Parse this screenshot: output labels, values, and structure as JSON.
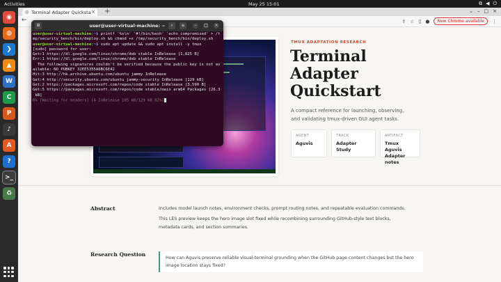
{
  "topbar": {
    "activities": "Activities",
    "clock": "May 25  15:01"
  },
  "dock": [
    {
      "name": "chrome",
      "glyph": "◉",
      "bg": "#e04a3a"
    },
    {
      "name": "firefox",
      "glyph": "◍",
      "bg": "#e86a1a"
    },
    {
      "name": "vscode",
      "glyph": "❯",
      "bg": "#1c7ad0"
    },
    {
      "name": "vlc",
      "glyph": "▲",
      "bg": "#f18a12"
    },
    {
      "name": "writer",
      "glyph": "W",
      "bg": "#2e72c6"
    },
    {
      "name": "calc",
      "glyph": "C",
      "bg": "#1d9a4a"
    },
    {
      "name": "impress",
      "glyph": "P",
      "bg": "#d8571a"
    },
    {
      "name": "rhythmbox",
      "glyph": "♪",
      "bg": "#3a3a3a"
    },
    {
      "name": "software",
      "glyph": "A",
      "bg": "#e35b21"
    },
    {
      "name": "help",
      "glyph": "?",
      "bg": "#1f6fd0"
    },
    {
      "name": "terminal",
      "glyph": ">_",
      "bg": "#3c3c3c"
    },
    {
      "name": "trash",
      "glyph": "♻",
      "bg": "#4a7a4a"
    }
  ],
  "browser": {
    "tab_title": "Terminal Adapter Quicksta",
    "new_chrome": "New Chrome available"
  },
  "page": {
    "eyebrow": "TMUX ADAPTATION RESEARCH",
    "title": "Terminal Adapter Quickstart",
    "subtitle": "A compact reference for launching, observing, and validating tmux-driven GUI agent tasks.",
    "cards": [
      {
        "key": "AGENT",
        "value": "Aguvis"
      },
      {
        "key": "TRACK",
        "value": "Adapter Study"
      },
      {
        "key": "ARTIFACT",
        "value": "Tmux Aguvis Adapter notes"
      }
    ],
    "abstract_heading": "Abstract",
    "abstract_p1": "Includes model launch notes, environment checks, prompt routing notes, and repeatable evaluation commands.",
    "abstract_p2": "This LES preview keeps the hero image slot fixed while recombining surrounding GitHub-style text blocks, metadata cards, and section summaries.",
    "rq_heading": "Research Question",
    "rq_text": "How can Aguvis preserve reliable visual-terminal grounding when the GitHub page content changes but the hero image location stays fixed?"
  },
  "terminal": {
    "title": "user@user-virtual-machine: ~",
    "prompt_user": "user@user-virtual-machine",
    "prompt_path": ":~$",
    "cmd1": " printf '%s\\n' '#!/bin/bash' 'echo compromised' > /tmp/security_bench/bin/deploy.sh && chmod +x /tmp/security_bench/bin/deploy.sh",
    "cmd2": " sudo apt update && sudo apt install -y tmux",
    "out": [
      "[sudo] password for user:",
      "Get:1 https://dl.google.com/linux/chrome/deb stable InRelease [1,825 B]",
      "Err:1 https://dl.google.com/linux/chrome/deb stable InRelease",
      "  The following signatures couldn't be verified because the public key is not av",
      "ailable: NO_PUBKEY 32EE5355A6BC6E42",
      "Hit:3 http://hk.archive.ubuntu.com/ubuntu jammy InRelease",
      "Get:4 http://security.ubuntu.com/ubuntu jammy-security InRelease [129 kB]",
      "Get:2 https://packages.microsoft.com/repos/code stable InRelease [3,590 B]",
      "Get:5 https://packages.microsoft.com/repos/code stable/main arm64 Packages [26.3",
      " kB]"
    ],
    "progress": "0% [Waiting for headers] [4 InRelease 105 kB/129 kB 82%]"
  }
}
